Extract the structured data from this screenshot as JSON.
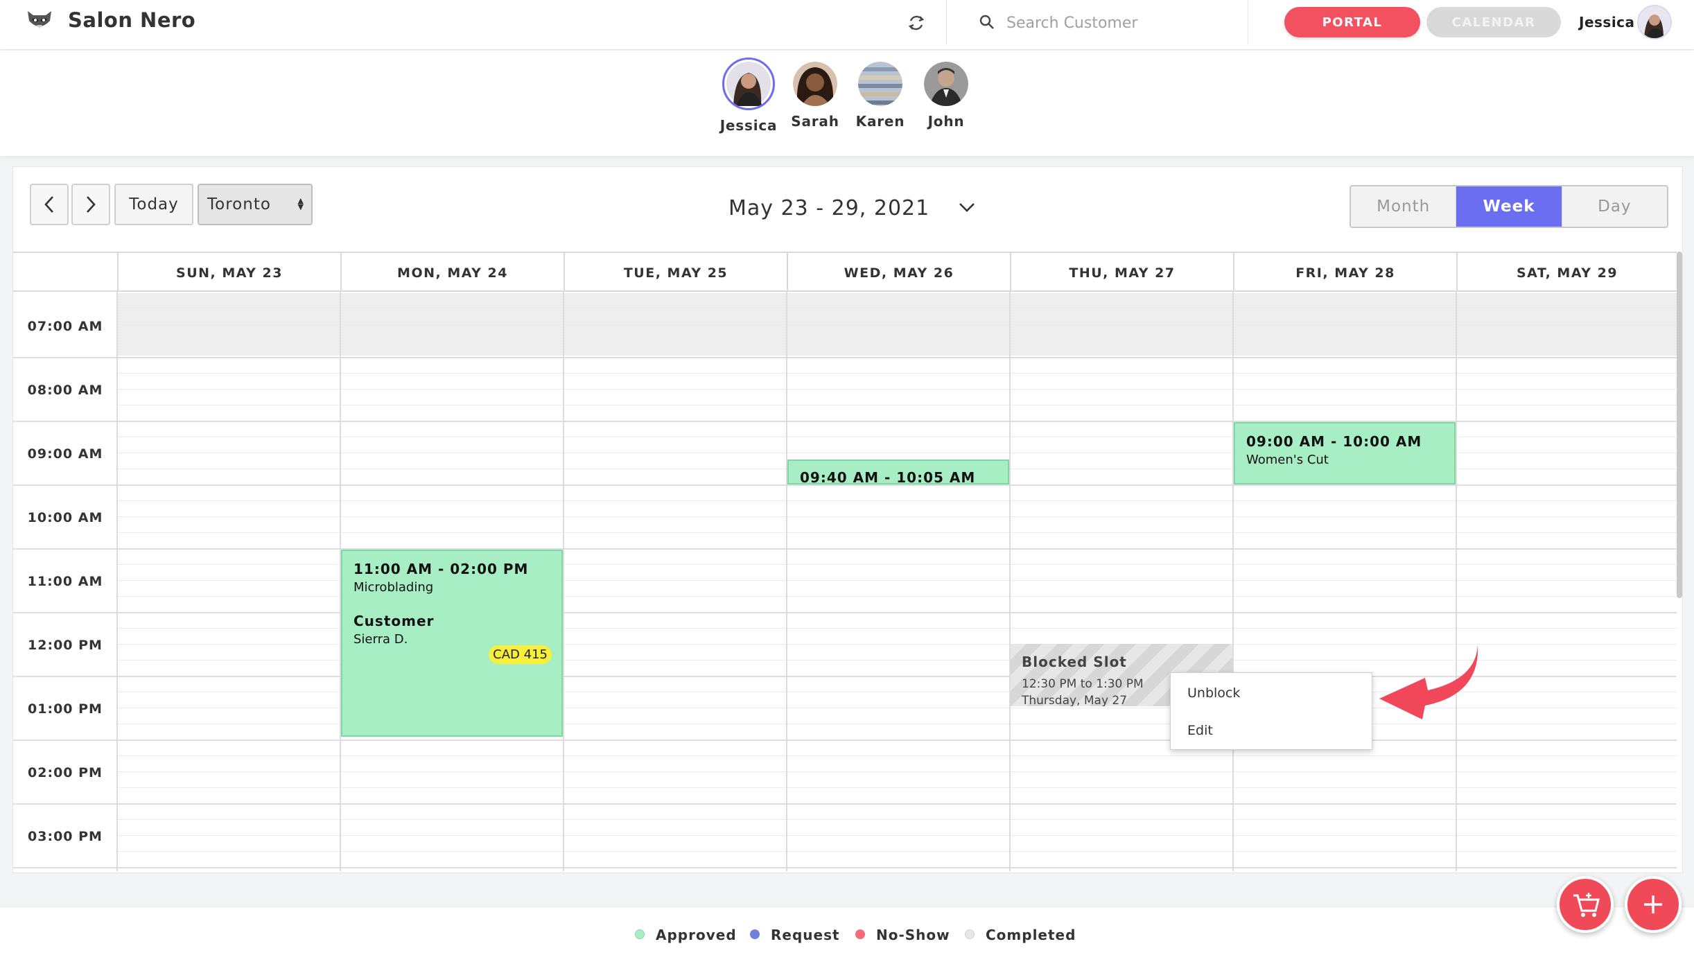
{
  "header": {
    "app_title": "Salon Nero",
    "search_placeholder": "Search Customer",
    "portal_label": "PORTAL",
    "calendar_label": "CALENDAR",
    "user_name": "Jessica",
    "icons": [
      "raccoon-logo-icon",
      "refresh-icon",
      "search-icon"
    ]
  },
  "staff": [
    {
      "name": "Jessica",
      "active": true
    },
    {
      "name": "Sarah",
      "active": false
    },
    {
      "name": "Karen",
      "active": false
    },
    {
      "name": "John",
      "active": false
    }
  ],
  "toolbar": {
    "today_label": "Today",
    "timezone": "Toronto",
    "range_label": "May 23 - 29, 2021",
    "views": [
      "Month",
      "Week",
      "Day"
    ],
    "active_view": "Week"
  },
  "calendar": {
    "days": [
      "SUN, MAY 23",
      "MON, MAY 24",
      "TUE, MAY 25",
      "WED, MAY 26",
      "THU, MAY 27",
      "FRI, MAY 28",
      "SAT, MAY 29"
    ],
    "times": [
      "07:00 AM",
      "08:00 AM",
      "09:00 AM",
      "10:00 AM",
      "11:00 AM",
      "12:00 PM",
      "01:00 PM",
      "02:00 PM",
      "03:00 PM"
    ],
    "appointments": {
      "mon": {
        "time": "11:00 AM - 02:00 PM",
        "service": "Microblading",
        "customer_label": "Customer",
        "customer": "Sierra D.",
        "price": "CAD 415"
      },
      "wed": {
        "time": "09:40 AM - 10:05 AM"
      },
      "fri": {
        "time": "09:00 AM - 10:00 AM",
        "service": "Women's Cut"
      }
    },
    "blocked": {
      "title": "Blocked Slot",
      "time": "12:30 PM to 1:30 PM",
      "date": "Thursday, May 27"
    }
  },
  "context_menu": {
    "items": [
      "Unblock",
      "Edit"
    ]
  },
  "legend": [
    {
      "label": "Approved",
      "color": "#a8eec4"
    },
    {
      "label": "Request",
      "color": "#6e7fe0"
    },
    {
      "label": "No-Show",
      "color": "#f36c7a"
    },
    {
      "label": "Completed",
      "color": "#e8e8e8"
    }
  ],
  "colors": {
    "accent": "#f35060",
    "week_active": "#6b6ef0",
    "approved": "#a8eec4"
  }
}
